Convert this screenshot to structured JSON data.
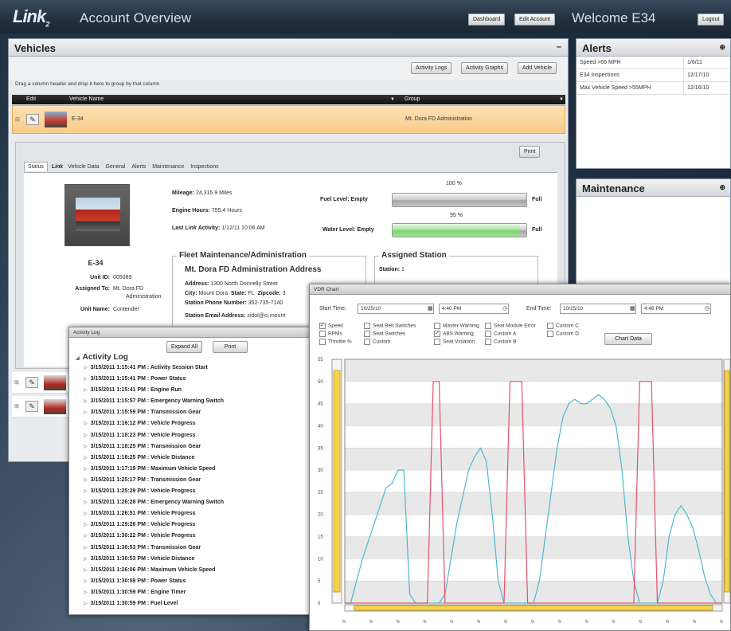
{
  "header": {
    "logo": "Link",
    "logo_sub": "2",
    "title": "Account Overview",
    "dashboard": "Dashboard",
    "edit_account": "Edit Account",
    "welcome": "Welcome E34",
    "logout": "Logout"
  },
  "vehicles": {
    "title": "Vehicles",
    "collapse": "–",
    "activity_logs": "Activity Logs",
    "activity_graphs": "Activity Graphs",
    "add_vehicle": "Add Vehicle",
    "group_hint": "Drag a column header and drop it here to group by that column",
    "col_edit": "Edit",
    "col_name": "Vehicle Name",
    "col_group": "Group",
    "row_name": "E-34",
    "row_group": "Mt. Dora FD Administration",
    "print": "Print",
    "tabs": [
      "Status",
      "Vehicle Data",
      "General",
      "Alerts",
      "Maintenance",
      "Inspections"
    ],
    "unit_title": "E-34",
    "unit_id_label": "Unit ID:",
    "unit_id": "005089",
    "assigned_label": "Assigned To:",
    "assigned_1": "Mt. Dora FD",
    "assigned_2": "Administration",
    "unit_name_label": "Unit Name:",
    "unit_name": "Contender",
    "mileage_label": "Mileage:",
    "mileage": "24,315.9 Miles",
    "hours_label": "Engine Hours:",
    "hours": "755.4 Hours",
    "last_label_a": "Last",
    "last_label_b": "Activity:",
    "last_value": "1/12/11 10:06 AM",
    "fuel_label": "Fuel Level:",
    "fuel_empty": "Empty",
    "fuel_full": "Full",
    "fuel_pct": "100 %",
    "fuel_level": 1.0,
    "water_label": "Water Level:",
    "water_empty": "Empty",
    "water_full": "Full",
    "water_pct": "95 %",
    "water_level": 0.95,
    "fleet_title": "Fleet Maintenance/Administration",
    "addr_title": "Mt. Dora FD Administration Address",
    "address_label": "Address:",
    "address": "1300 North Donnelly Street",
    "city_label": "City:",
    "city": "Mount Dora",
    "state_label": "State:",
    "state": "FL",
    "zip_label": "Zipcode:",
    "zip": "3",
    "phone_label": "Station Phone Number:",
    "phone": "352-735-7140",
    "email_label": "Station Email Address:",
    "email": "zidol@ci.mount",
    "assigned_station_title": "Assigned Station",
    "station_label": "Station:",
    "station": "1"
  },
  "alerts": {
    "title": "Alerts",
    "rows": [
      {
        "name": "Speed >65 MPH",
        "date": "1/6/11"
      },
      {
        "name": "E34 Inspections",
        "date": "12/17/10"
      },
      {
        "name": "Max Vehicle Speed >55MPH",
        "date": "12/16/10"
      }
    ]
  },
  "maintenance": {
    "title": "Maintenance"
  },
  "activity_log": {
    "window_title": "Activity Log",
    "expand_all": "Expand All",
    "print": "Print",
    "heading": "Activity Log",
    "entries": [
      "3/15/2011 1:15:41 PM : Activity Session Start",
      "3/15/2011 1:15:41 PM : Power Status",
      "3/15/2011 1:15:41 PM : Engine Run",
      "3/15/2011 1:15:57 PM : Emergency Warning Switch",
      "3/15/2011 1:15:59 PM : Transmission Gear",
      "3/15/2011 1:16:12 PM : Vehicle Progress",
      "3/15/2011 1:18:23 PM : Vehicle Progress",
      "3/15/2011 1:18:25 PM : Transmission Gear",
      "3/15/2011 1:18:25 PM : Vehicle Distance",
      "3/15/2011 1:17:19 PM : Maximum Vehicle Speed",
      "3/15/2011 1:25:17 PM : Transmission Gear",
      "3/15/2011 1:25:29 PM : Vehicle Progress",
      "3/15/2011 1:26:28 PM : Emergency Warning Switch",
      "3/15/2011 1:26:51 PM : Vehicle Progress",
      "3/15/2011 1:29:26 PM : Vehicle Progress",
      "3/15/2011 1:30:22 PM : Vehicle Progress",
      "3/15/2011 1:30:53 PM : Transmission Gear",
      "3/15/2011 1:30:53 PM : Vehicle Distance",
      "3/15/2011 1:26:06 PM : Maximum Vehicle Speed",
      "3/15/2011 1:30:59 PM : Power Status",
      "3/15/2011 1:30:59 PM : Engine Timer",
      "3/15/2011 1:30:59 PM : Fuel Level"
    ]
  },
  "vdr_chart": {
    "window_title": "VDR Chart",
    "start_label": "Start Time:",
    "start_date": "10/25/10",
    "start_time": "4:40 PM",
    "end_label": "End Time:",
    "end_date": "10/25/10",
    "end_time": "4:46 PM",
    "chart_data_btn": "Chart Data",
    "options": [
      {
        "label": "Speed",
        "checked": true
      },
      {
        "label": "Seat Belt Switches",
        "checked": false
      },
      {
        "label": "Master Warning",
        "checked": false
      },
      {
        "label": "Seat Module Error",
        "checked": false
      },
      {
        "label": "Custom C",
        "checked": false
      },
      {
        "label": "RPMs",
        "checked": false
      },
      {
        "label": "Seat Switches",
        "checked": false
      },
      {
        "label": "ABS Warning",
        "checked": true
      },
      {
        "label": "Custom A",
        "checked": false
      },
      {
        "label": "Custom D",
        "checked": false
      },
      {
        "label": "Throttle %",
        "checked": false
      },
      {
        "label": "Custom",
        "checked": false
      },
      {
        "label": "Seat Violation",
        "checked": false
      },
      {
        "label": "Custom B",
        "checked": false
      }
    ]
  },
  "chart_data": {
    "type": "line",
    "ylim": [
      0,
      55
    ],
    "yticks": [
      0,
      5,
      10,
      15,
      20,
      25,
      30,
      35,
      40,
      45,
      50,
      55
    ],
    "xtick_label": "0",
    "xtick_count": 15,
    "grid": true,
    "colors": {
      "speed": "#4db8d4",
      "abs": "#e8506a"
    },
    "series": [
      {
        "values": [
          0,
          0,
          5,
          10,
          14,
          18,
          22,
          26,
          27,
          30,
          30,
          2,
          0,
          0,
          0,
          0,
          0,
          2,
          10,
          18,
          24,
          30,
          33,
          35,
          32,
          20,
          5,
          0,
          0,
          0,
          0,
          0,
          0,
          5,
          15,
          25,
          35,
          42,
          45,
          46,
          45,
          45,
          46,
          47,
          46,
          44,
          40,
          30,
          15,
          5,
          0,
          0,
          0,
          0,
          5,
          15,
          20,
          22,
          20,
          17,
          12,
          6,
          2,
          0,
          0
        ]
      },
      {
        "values": [
          0,
          0,
          0,
          0,
          0,
          0,
          0,
          0,
          0,
          0,
          0,
          0,
          0,
          0,
          0,
          50,
          50,
          0,
          0,
          0,
          0,
          0,
          0,
          0,
          0,
          0,
          0,
          0,
          50,
          50,
          50,
          0,
          0,
          0,
          0,
          0,
          0,
          0,
          0,
          0,
          0,
          0,
          0,
          0,
          0,
          0,
          0,
          0,
          0,
          0,
          50,
          50,
          50,
          0,
          0,
          0,
          0,
          0,
          0,
          0,
          0,
          0,
          0,
          0,
          0
        ]
      }
    ]
  }
}
